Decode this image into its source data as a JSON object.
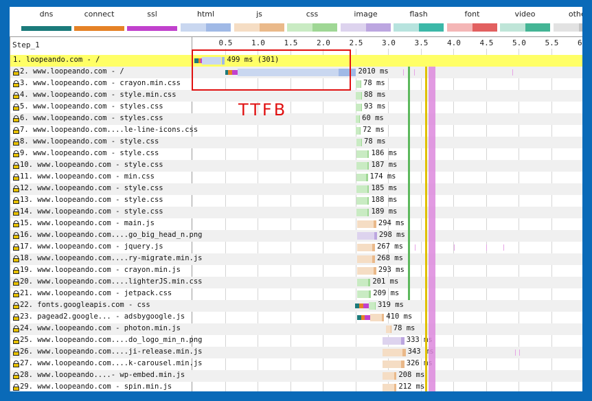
{
  "legend": [
    {
      "label": "dns",
      "type": "solid",
      "color": "#1c7b7b"
    },
    {
      "label": "connect",
      "type": "solid",
      "color": "#e58226"
    },
    {
      "label": "ssl",
      "type": "solid",
      "color": "#c141cd"
    },
    {
      "label": "html",
      "type": "pair",
      "light": "#c9d7f0",
      "dark": "#a0b9e6"
    },
    {
      "label": "js",
      "type": "pair",
      "light": "#f5ddc4",
      "dark": "#eab98a"
    },
    {
      "label": "css",
      "type": "pair",
      "light": "#c9ebc3",
      "dark": "#9fd795"
    },
    {
      "label": "image",
      "type": "pair",
      "light": "#ddd3ee",
      "dark": "#bca6e0"
    },
    {
      "label": "flash",
      "type": "pair",
      "light": "#b7e3de",
      "dark": "#3cb8a8"
    },
    {
      "label": "font",
      "type": "pair",
      "light": "#f4b6b6",
      "dark": "#e26060"
    },
    {
      "label": "video",
      "type": "pair",
      "light": "#bfe5d8",
      "dark": "#44b595"
    },
    {
      "label": "other",
      "type": "pair",
      "light": "#e2e2e2",
      "dark": "#c4c4c4"
    }
  ],
  "step_label": "Step_1",
  "axis_ticks": [
    "0.5",
    "1.0",
    "1.5",
    "2.0",
    "2.5",
    "3.0",
    "3.5",
    "4.0",
    "4.5",
    "5.0",
    "5.5",
    "6"
  ],
  "marker_lines": [
    {
      "time": 3.31,
      "color": "#5cb85c"
    },
    {
      "time": 3.57,
      "color": "#e0c000"
    },
    {
      "time": 3.62,
      "color": "#dd88dd"
    }
  ],
  "annotation": "TTFB",
  "rows": [
    {
      "name": "1. loopeando.com - /",
      "ms": "499 ms (301)",
      "kind": "html",
      "start": 0.03,
      "end": 0.5,
      "dns": 0.06,
      "connect": 0.04,
      "ssl": 0.02,
      "lock": false,
      "highlight": true
    },
    {
      "name": "2. www.loopeando.com - /",
      "ms": "2010 ms",
      "kind": "html",
      "start": 0.5,
      "end": 2.51,
      "dns": 0.05,
      "connect": 0.06,
      "ssl": 0.08,
      "lock": true
    },
    {
      "name": "3. www.loopeando.com - crayon.min.css",
      "ms": "78 ms",
      "kind": "css",
      "start": 2.51,
      "end": 2.59,
      "lock": true
    },
    {
      "name": "4. www.loopeando.com - style.min.css",
      "ms": "88 ms",
      "kind": "css",
      "start": 2.51,
      "end": 2.6,
      "lock": true
    },
    {
      "name": "5. www.loopeando.com - styles.css",
      "ms": "93 ms",
      "kind": "css",
      "start": 2.51,
      "end": 2.6,
      "lock": true
    },
    {
      "name": "6. www.loopeando.com - styles.css",
      "ms": "60 ms",
      "kind": "css",
      "start": 2.51,
      "end": 2.57,
      "lock": true
    },
    {
      "name": "7. www.loopeando.com....le-line-icons.css",
      "ms": "72 ms",
      "kind": "css",
      "start": 2.51,
      "end": 2.58,
      "lock": true
    },
    {
      "name": "8. www.loopeando.com - style.css",
      "ms": "78 ms",
      "kind": "css",
      "start": 2.52,
      "end": 2.6,
      "lock": true
    },
    {
      "name": "9. www.loopeando.com - style.css",
      "ms": "186 ms",
      "kind": "css",
      "start": 2.52,
      "end": 2.71,
      "lock": true
    },
    {
      "name": "10. www.loopeando.com - style.css",
      "ms": "187 ms",
      "kind": "css",
      "start": 2.52,
      "end": 2.71,
      "lock": true
    },
    {
      "name": "11. www.loopeando.com - min.css",
      "ms": "174 ms",
      "kind": "css",
      "start": 2.52,
      "end": 2.69,
      "lock": true
    },
    {
      "name": "12. www.loopeando.com - style.css",
      "ms": "185 ms",
      "kind": "css",
      "start": 2.52,
      "end": 2.71,
      "lock": true
    },
    {
      "name": "13. www.loopeando.com - style.css",
      "ms": "188 ms",
      "kind": "css",
      "start": 2.52,
      "end": 2.71,
      "lock": true
    },
    {
      "name": "14. www.loopeando.com - style.css",
      "ms": "189 ms",
      "kind": "css",
      "start": 2.52,
      "end": 2.71,
      "lock": true
    },
    {
      "name": "15. www.loopeando.com - main.js",
      "ms": "294 ms",
      "kind": "js",
      "start": 2.53,
      "end": 2.82,
      "lock": true
    },
    {
      "name": "16. www.loopeando.com....go_big_head_n.png",
      "ms": "298 ms",
      "kind": "image",
      "start": 2.53,
      "end": 2.83,
      "lock": true
    },
    {
      "name": "17. www.loopeando.com - jquery.js",
      "ms": "267 ms",
      "kind": "js",
      "start": 2.53,
      "end": 2.8,
      "lock": true
    },
    {
      "name": "18. www.loopeando.com....ry-migrate.min.js",
      "ms": "268 ms",
      "kind": "js",
      "start": 2.53,
      "end": 2.8,
      "lock": true
    },
    {
      "name": "19. www.loopeando.com - crayon.min.js",
      "ms": "293 ms",
      "kind": "js",
      "start": 2.53,
      "end": 2.82,
      "lock": true
    },
    {
      "name": "20. www.loopeando.com....lighterJS.min.css",
      "ms": "201 ms",
      "kind": "css",
      "start": 2.53,
      "end": 2.73,
      "lock": true
    },
    {
      "name": "21. www.loopeando.com - jetpack.css",
      "ms": "209 ms",
      "kind": "css",
      "start": 2.53,
      "end": 2.74,
      "lock": true
    },
    {
      "name": "22. fonts.googleapis.com - css",
      "ms": "319 ms",
      "kind": "css",
      "start": 2.49,
      "end": 2.81,
      "dns": 0.07,
      "connect": 0.06,
      "ssl": 0.09,
      "lock": true
    },
    {
      "name": "23. pagead2.google... - adsbygoogle.js",
      "ms": "410 ms",
      "kind": "js",
      "start": 2.53,
      "end": 2.94,
      "dns": 0.06,
      "connect": 0.05,
      "ssl": 0.09,
      "lock": true
    },
    {
      "name": "24. www.loopeando.com - photon.min.js",
      "ms": "78 ms",
      "kind": "js",
      "start": 2.97,
      "end": 3.05,
      "lock": true
    },
    {
      "name": "25. www.loopeando.com....do_logo_min_n.png",
      "ms": "333 ms",
      "kind": "image",
      "start": 2.92,
      "end": 3.25,
      "lock": true
    },
    {
      "name": "26. www.loopeando.com....ji-release.min.js",
      "ms": "343 ms",
      "kind": "js",
      "start": 2.92,
      "end": 3.27,
      "lock": true
    },
    {
      "name": "27. www.loopeando.com....k-carousel.min.js",
      "ms": "326 ms",
      "kind": "js",
      "start": 2.92,
      "end": 3.25,
      "lock": true
    },
    {
      "name": "28. www.loopeando....- wp-embed.min.js",
      "ms": "208 ms",
      "kind": "js",
      "start": 2.92,
      "end": 3.13,
      "lock": true
    },
    {
      "name": "29. www.loopeando.com - spin.min.js",
      "ms": "212 ms",
      "kind": "js",
      "start": 2.92,
      "end": 3.13,
      "lock": true
    }
  ]
}
